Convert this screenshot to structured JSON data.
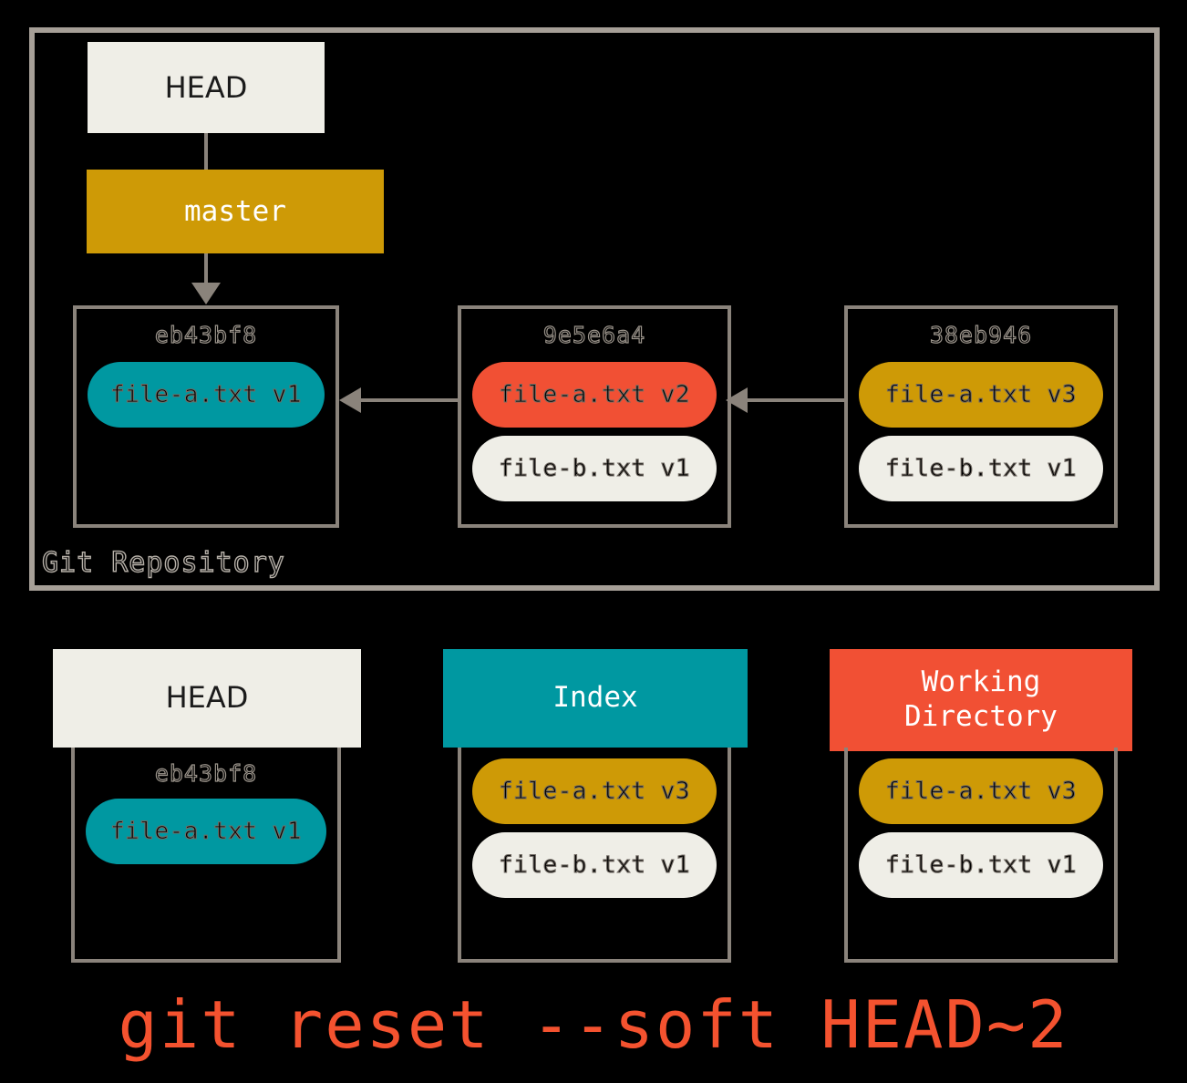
{
  "colors": {
    "background": "#000000",
    "cream": "#efeee7",
    "teal": "#0098a1",
    "red": "#f15034",
    "gold": "#ce9a06",
    "border_grey": "#8a837b",
    "frame_grey": "#a69f97",
    "command_red": "#f4522f"
  },
  "repository": {
    "label": "Git Repository",
    "head_box": {
      "label": "HEAD"
    },
    "branch_box": {
      "label": "master"
    },
    "commits": [
      {
        "hash": "eb43bf8",
        "files": [
          {
            "label": "file-a.txt v1",
            "color": "teal"
          }
        ]
      },
      {
        "hash": "9e5e6a4",
        "files": [
          {
            "label": "file-a.txt v2",
            "color": "red"
          },
          {
            "label": "file-b.txt v1",
            "color": "cream"
          }
        ]
      },
      {
        "hash": "38eb946",
        "files": [
          {
            "label": "file-a.txt v3",
            "color": "gold"
          },
          {
            "label": "file-b.txt v1",
            "color": "cream"
          }
        ]
      }
    ]
  },
  "areas": [
    {
      "title": "HEAD",
      "hash": "eb43bf8",
      "files": [
        {
          "label": "file-a.txt v1",
          "color": "teal"
        }
      ]
    },
    {
      "title": "Index",
      "hash": "",
      "files": [
        {
          "label": "file-a.txt v3",
          "color": "gold"
        },
        {
          "label": "file-b.txt v1",
          "color": "cream"
        }
      ]
    },
    {
      "title": "Working\nDirectory",
      "hash": "",
      "files": [
        {
          "label": "file-a.txt v3",
          "color": "gold"
        },
        {
          "label": "file-b.txt v1",
          "color": "cream"
        }
      ]
    }
  ],
  "command": "git reset --soft HEAD~2"
}
